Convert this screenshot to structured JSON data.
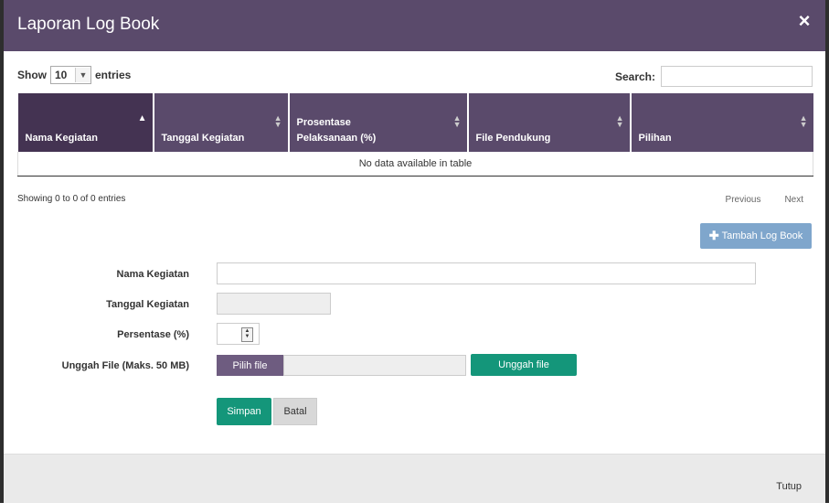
{
  "modal": {
    "title": "Laporan Log Book",
    "close_icon": "×"
  },
  "table_controls": {
    "show_label": "Show",
    "entries_value": "10",
    "entries_label": "entries",
    "search_label": "Search:",
    "search_value": ""
  },
  "table": {
    "columns": [
      {
        "label": "Nama Kegiatan",
        "sort": "asc"
      },
      {
        "label": "Tanggal Kegiatan",
        "sort": "both"
      },
      {
        "label": "Prosentase Pelaksanaan (%)",
        "sort": "both"
      },
      {
        "label": "File Pendukung",
        "sort": "both"
      },
      {
        "label": "Pilihan",
        "sort": "both"
      }
    ],
    "empty_message": "No data available in table"
  },
  "pagination": {
    "info": "Showing 0 to 0 of 0 entries",
    "previous": "Previous",
    "next": "Next"
  },
  "actions": {
    "add_label": "Tambah Log Book",
    "add_icon": "plus-icon"
  },
  "form": {
    "nama_label": "Nama Kegiatan",
    "nama_value": "",
    "tanggal_label": "Tanggal Kegiatan",
    "tanggal_value": "",
    "persentase_label": "Persentase (%)",
    "persentase_value": "",
    "upload_label": "Unggah File (Maks. 50 MB)",
    "pick_file_label": "Pilih file",
    "upload_button_label": "Unggah file",
    "save_label": "Simpan",
    "cancel_label": "Batal"
  },
  "footer": {
    "close_label": "Tutup"
  },
  "colors": {
    "header": "#5a4a6b",
    "accent_green": "#14967a",
    "add_button": "#7fa6cc"
  }
}
